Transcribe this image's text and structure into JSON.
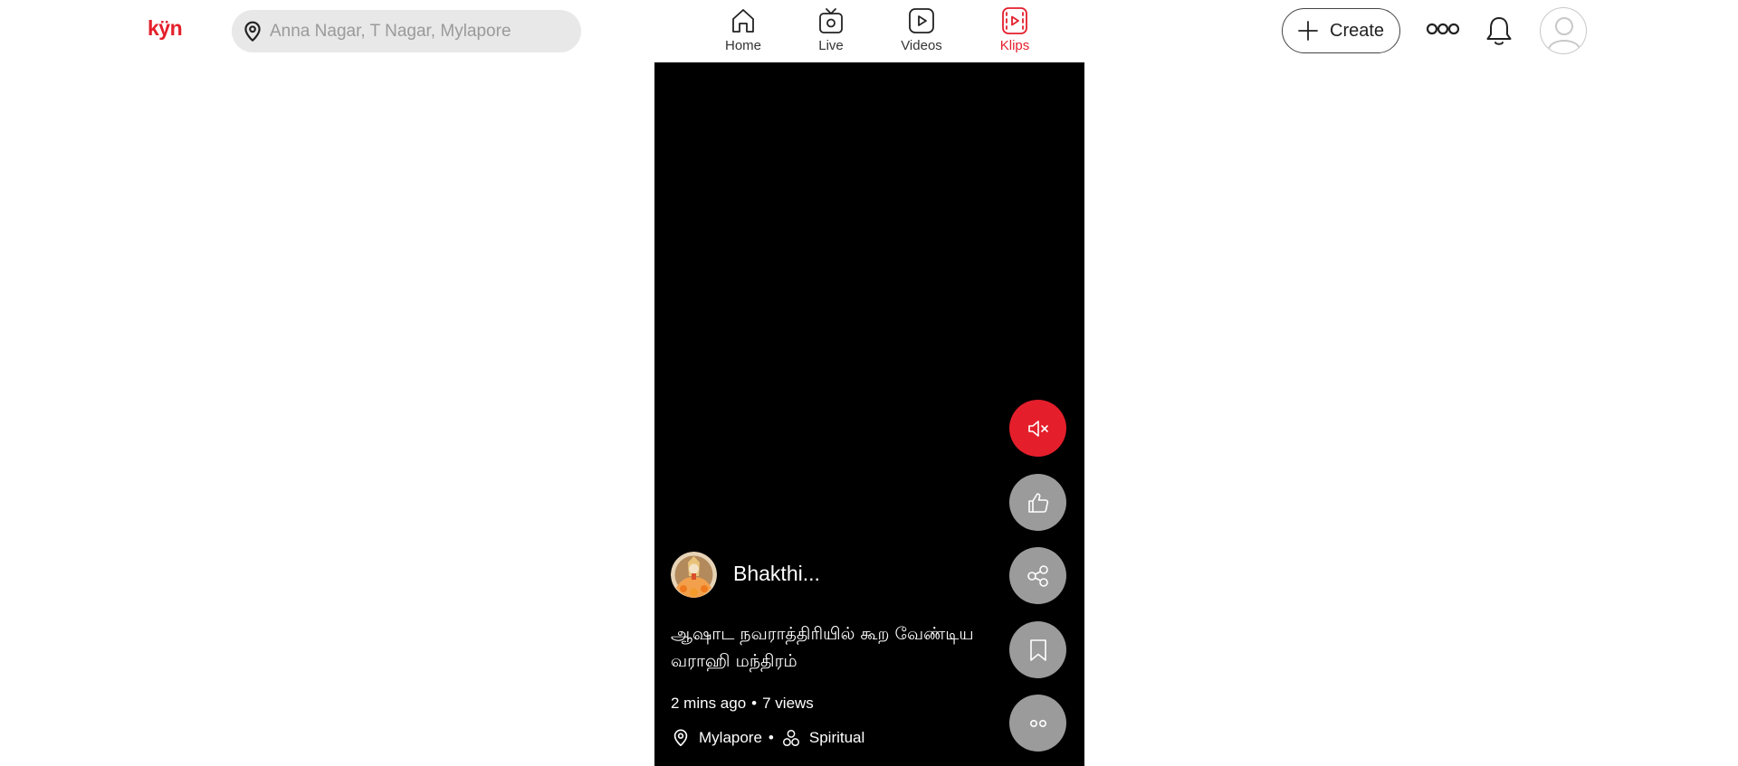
{
  "brand": {
    "logo_text": "kÿn",
    "accent_color": "#e41f2b"
  },
  "search": {
    "placeholder": "Anna Nagar, T Nagar, Mylapore",
    "value": "",
    "icon": "location-pin-icon"
  },
  "nav": {
    "items": [
      {
        "label": "Home",
        "icon": "home-icon",
        "active": false
      },
      {
        "label": "Live",
        "icon": "live-tv-icon",
        "active": false
      },
      {
        "label": "Videos",
        "icon": "video-play-icon",
        "active": false
      },
      {
        "label": "Klips",
        "icon": "klips-reel-icon",
        "active": true
      }
    ]
  },
  "header_actions": {
    "create_label": "Create",
    "create_icon": "plus-icon",
    "more_icon": "more-icon",
    "notifications_icon": "bell-icon",
    "avatar_icon": "user-avatar-icon"
  },
  "klip": {
    "channel_name": "Bhakthi...",
    "caption": "ஆஷாட நவராத்திரியில் கூற வேண்டிய வராஹி மந்திரம்",
    "time_ago": "2 mins ago",
    "views": "7 views",
    "location": "Mylapore",
    "category": "Spiritual",
    "background_color": "#000000"
  },
  "side_actions": [
    {
      "name": "mute",
      "icon": "volume-mute-icon",
      "color": "#e41f2b"
    },
    {
      "name": "like",
      "icon": "thumbs-up-icon",
      "color": "#9b9b9b"
    },
    {
      "name": "share",
      "icon": "share-icon",
      "color": "#9b9b9b"
    },
    {
      "name": "save",
      "icon": "bookmark-icon",
      "color": "#9b9b9b"
    },
    {
      "name": "more",
      "icon": "more-options-icon",
      "color": "#9b9b9b"
    }
  ]
}
